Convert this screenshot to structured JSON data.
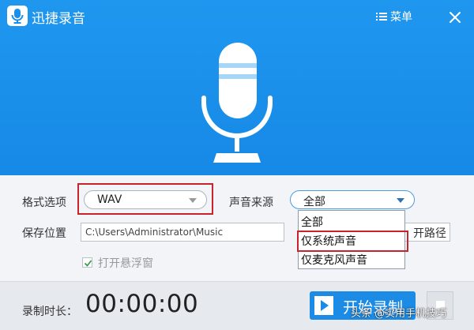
{
  "window": {
    "title": "迅捷录音",
    "menu_label": "菜单",
    "close_icon": "close-icon",
    "logo_icon": "microphone-icon"
  },
  "colors": {
    "header_blue": "#1a8fe9",
    "start_button": "#1b8be6",
    "highlight_red": "#c8232c"
  },
  "settings": {
    "format_label": "格式选项",
    "format_value": "WAV",
    "source_label": "声音来源",
    "source_value": "全部",
    "source_options": [
      "全部",
      "仅系统声音",
      "仅麦克风声音"
    ],
    "save_label": "保存位置",
    "save_path": "C:\\Users\\Administrator\\Music",
    "open_path_button": "开路径",
    "float_window_label": "打开悬浮窗",
    "float_window_checked": true
  },
  "bottom": {
    "duration_label": "录制时长：",
    "timer": "00:00:00",
    "start_button": "开始录制",
    "play_icon": "play-icon",
    "stop_icon": "stop-icon"
  },
  "watermark": "头条 @实用手机技巧"
}
